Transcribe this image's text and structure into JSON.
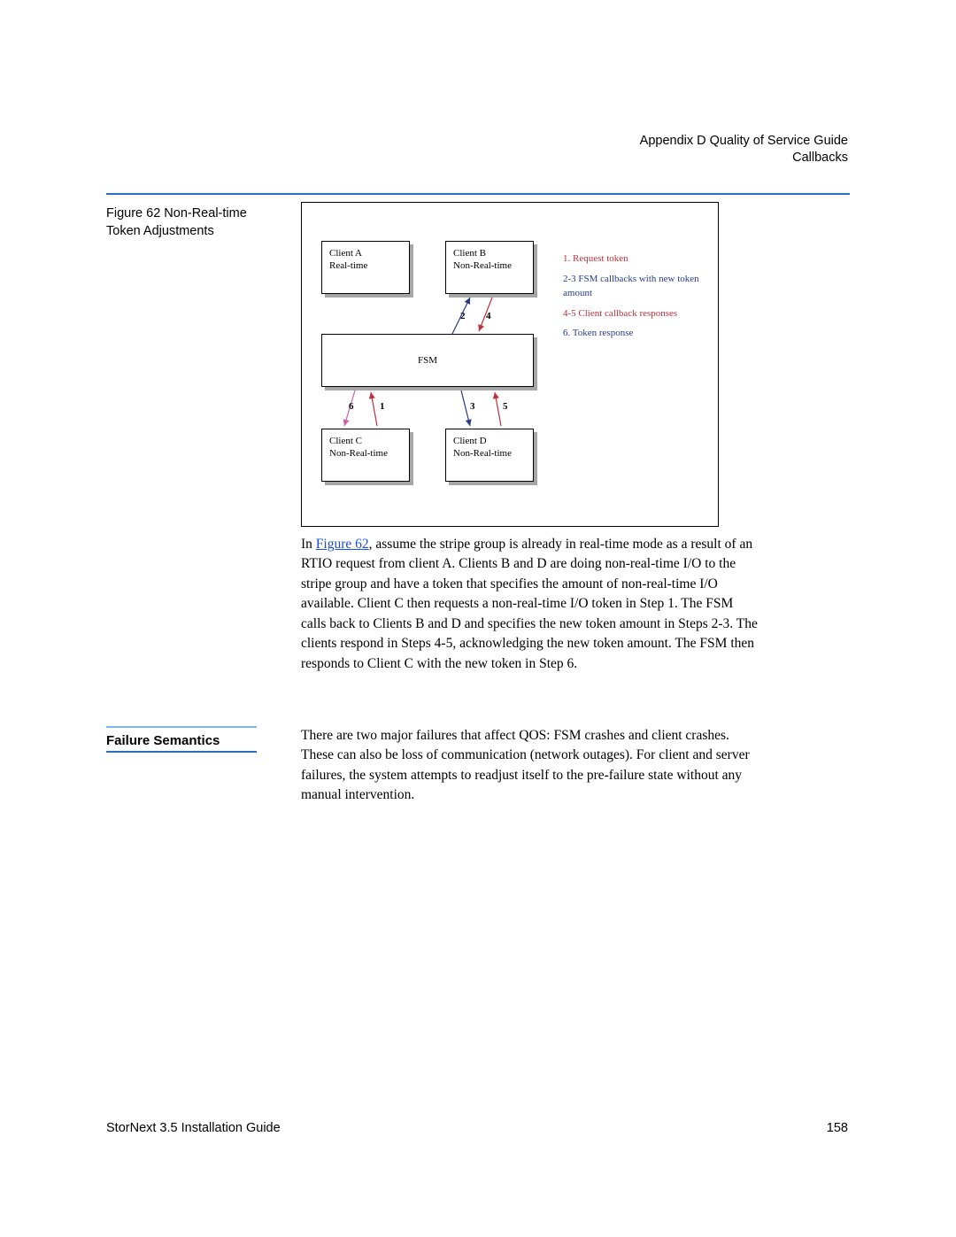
{
  "header": {
    "line1": "Appendix D  Quality of Service Guide",
    "line2": "Callbacks"
  },
  "figure": {
    "caption": "Figure 62  Non-Real-time Token Adjustments",
    "boxes": {
      "clientA": {
        "line1": "Client A",
        "line2": "Real-time"
      },
      "clientB": {
        "line1": "Client B",
        "line2": "Non-Real-time"
      },
      "fsm": "FSM",
      "clientC": {
        "line1": "Client C",
        "line2": "Non-Real-time"
      },
      "clientD": {
        "line1": "Client D",
        "line2": "Non-Real-time"
      }
    },
    "flow_labels": {
      "n1": "1",
      "n2": "2",
      "n3": "3",
      "n4": "4",
      "n5": "5",
      "n6": "6"
    },
    "legend": {
      "l1": "1. Request token",
      "l2": "2-3 FSM callbacks with new token amount",
      "l3": "4-5 Client callback responses",
      "l4": "6. Token response"
    }
  },
  "body": {
    "para1_pre": "In ",
    "para1_link": "Figure 62",
    "para1_post": ", assume the stripe group is already in real-time mode as a result of an RTIO request from client A. Clients B and D are doing non-real-time I/O to the stripe group and have a token that specifies the amount of non-real-time I/O available. Client C then requests a non-real-time I/O token in Step 1. The FSM calls back to Clients B and D and specifies the new token amount in Steps 2-3. The clients respond in Steps 4-5, acknowledging the new token amount. The FSM then responds to Client C with the new token in Step 6.",
    "section_title": "Failure Semantics",
    "para2": "There are two major failures that affect QOS: FSM crashes and client crashes. These can also be loss of communication (network outages). For client and server failures, the system attempts to readjust itself to the pre-failure state without any manual intervention."
  },
  "footer": {
    "left": "StorNext 3.5 Installation Guide",
    "page": "158"
  }
}
